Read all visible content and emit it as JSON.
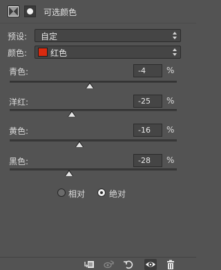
{
  "header": {
    "title": "可选颜色",
    "adjustment_icon": "selective-color-adjustment-icon",
    "mask_icon": "layer-mask-icon"
  },
  "preset": {
    "label": "预设:",
    "value": "自定"
  },
  "colors": {
    "label": "颜色:",
    "value": "红色",
    "swatch_color": "#d92a0f"
  },
  "sliders": [
    {
      "label": "青色:",
      "value": "-4",
      "unit": "%",
      "percent": -4
    },
    {
      "label": "洋红:",
      "value": "-25",
      "unit": "%",
      "percent": -25
    },
    {
      "label": "黄色:",
      "value": "-16",
      "unit": "%",
      "percent": -16
    },
    {
      "label": "黑色:",
      "value": "-28",
      "unit": "%",
      "percent": -28
    }
  ],
  "method": {
    "options": [
      "相对",
      "绝对"
    ],
    "selected": "绝对"
  },
  "toolbar": {
    "buttons": [
      "clip-to-layer-icon",
      "view-previous-state-icon",
      "reset-icon",
      "visibility-eye-icon",
      "delete-trash-icon"
    ]
  }
}
